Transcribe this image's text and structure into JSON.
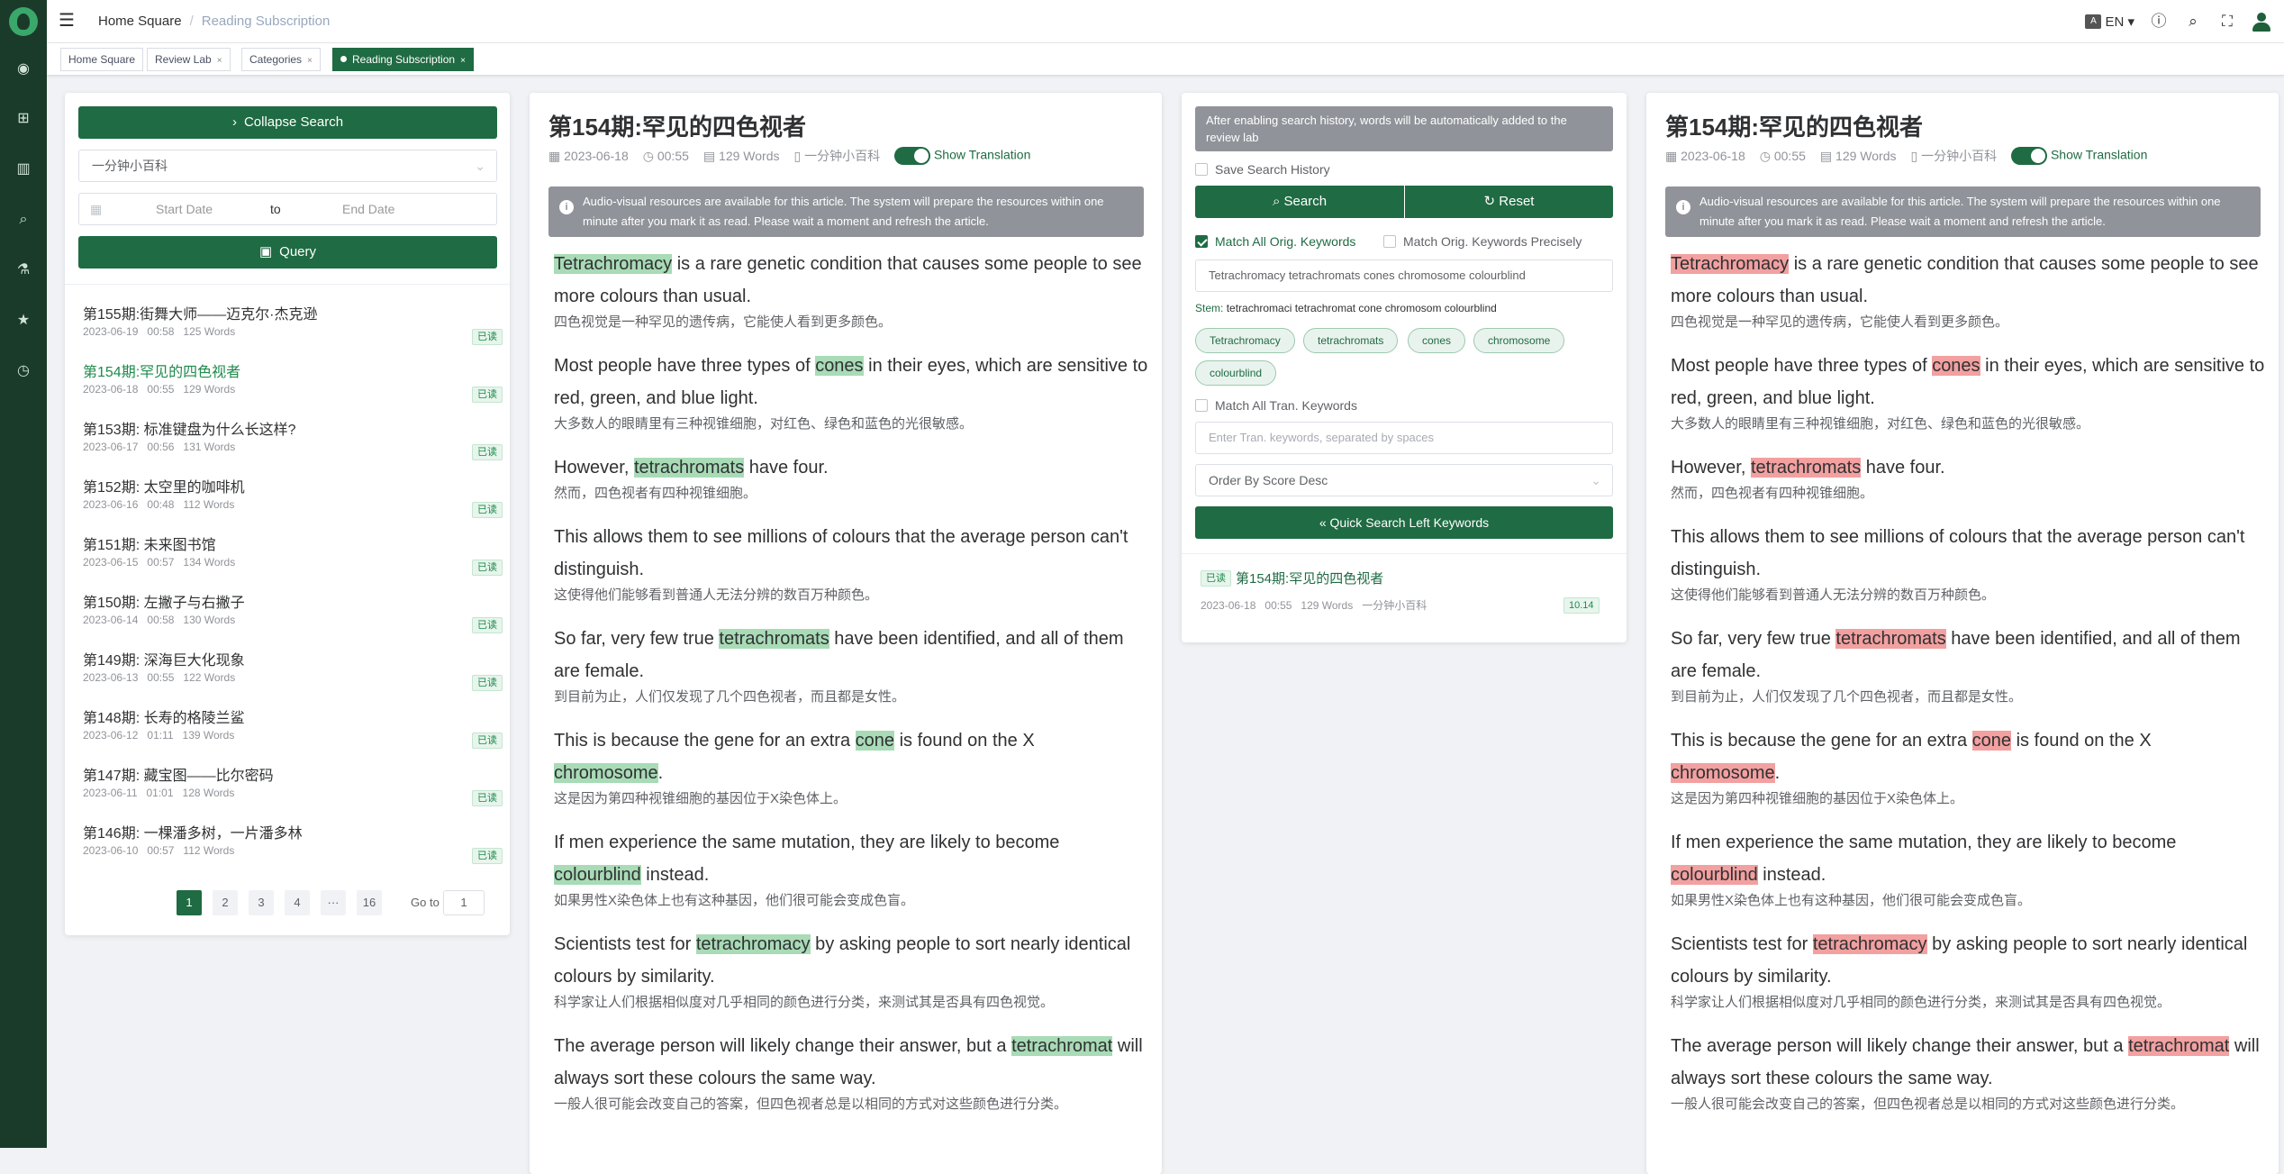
{
  "header": {
    "crumb_home": "Home Square",
    "crumb_sep": "/",
    "crumb_current": "Reading Subscription",
    "lang_box": "A",
    "lang": "EN ▾"
  },
  "tabs": [
    {
      "label": "Home Square"
    },
    {
      "label": "Review Lab"
    },
    {
      "label": "Categories"
    },
    {
      "label": "Reading Subscription"
    }
  ],
  "tab_close": "×",
  "search": {
    "collapse_label": "Collapse Search",
    "category": "一分钟小百科",
    "start_placeholder": "Start Date",
    "to": "to",
    "end_placeholder": "End Date",
    "query_label": "Query"
  },
  "list": [
    {
      "title": "第155期:街舞大师——迈克尔·杰克逊",
      "date": "2023-06-19",
      "dur": "00:58",
      "words": "125 Words",
      "badge": "已读"
    },
    {
      "title": "第154期:罕见的四色视者",
      "date": "2023-06-18",
      "dur": "00:55",
      "words": "129 Words",
      "badge": "已读"
    },
    {
      "title": "第153期: 标准键盘为什么长这样?",
      "date": "2023-06-17",
      "dur": "00:56",
      "words": "131 Words",
      "badge": "已读"
    },
    {
      "title": "第152期: 太空里的咖啡机",
      "date": "2023-06-16",
      "dur": "00:48",
      "words": "112 Words",
      "badge": "已读"
    },
    {
      "title": "第151期: 未来图书馆",
      "date": "2023-06-15",
      "dur": "00:57",
      "words": "134 Words",
      "badge": "已读"
    },
    {
      "title": "第150期: 左撇子与右撇子",
      "date": "2023-06-14",
      "dur": "00:58",
      "words": "130 Words",
      "badge": "已读"
    },
    {
      "title": "第149期: 深海巨大化现象",
      "date": "2023-06-13",
      "dur": "00:55",
      "words": "122 Words",
      "badge": "已读"
    },
    {
      "title": "第148期: 长寿的格陵兰鲨",
      "date": "2023-06-12",
      "dur": "01:11",
      "words": "139 Words",
      "badge": "已读"
    },
    {
      "title": "第147期: 藏宝图——比尔密码",
      "date": "2023-06-11",
      "dur": "01:01",
      "words": "128 Words",
      "badge": "已读"
    },
    {
      "title": "第146期: 一棵潘多树，一片潘多林",
      "date": "2023-06-10",
      "dur": "00:57",
      "words": "112 Words",
      "badge": "已读"
    }
  ],
  "pager": {
    "p1": "1",
    "p2": "2",
    "p3": "3",
    "p4": "4",
    "more": "···",
    "last": "16",
    "goto": "Go to",
    "goto_val": "1"
  },
  "article": {
    "title": "第154期:罕见的四色视者",
    "date": "2023-06-18",
    "dur": "00:55",
    "words": "129 Words",
    "cat": "一分钟小百科",
    "show_translation": "Show Translation",
    "notice": "Audio-visual resources are available for this article. The system will prepare the resources within one minute after you mark it as read. Please wait a moment and refresh the article.",
    "sentences": [
      {
        "pre": "",
        "kw": "Tetrachromacy",
        "post": " is a rare genetic condition that causes some people to see more colours than usual.",
        "zh": "四色视觉是一种罕见的遗传病，它能使人看到更多颜色。"
      },
      {
        "pre": "Most people have three types of ",
        "kw": "cones",
        "post": " in their eyes, which are sensitive to red, green, and blue light.",
        "zh": "大多数人的眼睛里有三种视锥细胞，对红色、绿色和蓝色的光很敏感。"
      },
      {
        "pre": "However, ",
        "kw": "tetrachromats",
        "post": " have four.",
        "zh": "然而，四色视者有四种视锥细胞。"
      },
      {
        "pre": "This allows them to see millions of colours that the average person can't distinguish.",
        "kw": "",
        "post": "",
        "zh": "这使得他们能够看到普通人无法分辨的数百万种颜色。"
      },
      {
        "pre": "So far, very few true ",
        "kw": "tetrachromats",
        "post": " have been identified, and all of them are female.",
        "zh": "到目前为止，人们仅发现了几个四色视者，而且都是女性。"
      },
      {
        "pre": "This is because the gene for an extra ",
        "kw": "cone",
        "post": " is found on the X ",
        "kw2": "chromosome",
        "post2": ".",
        "zh": "这是因为第四种视锥细胞的基因位于X染色体上。"
      },
      {
        "pre": "If men experience the same mutation, they are likely to become ",
        "kw": "colourblind",
        "post": " instead.",
        "zh": "如果男性X染色体上也有这种基因，他们很可能会变成色盲。"
      },
      {
        "pre": "Scientists test for ",
        "kw": "tetrachromacy",
        "post": " by asking people to sort nearly identical colours by similarity.",
        "zh": "科学家让人们根据相似度对几乎相同的颜色进行分类，来测试其是否具有四色视觉。"
      },
      {
        "pre": "The average person will likely change their answer, but a ",
        "kw": "tetrachromat",
        "post": " will always sort these colours the same way.",
        "zh": "一般人很可能会改变自己的答案，但四色视者总是以相同的方式对这些颜色进行分类。"
      }
    ]
  },
  "kw_search": {
    "info": "After enabling search history, words will be automatically added to the review lab",
    "save_history": "Save Search History",
    "search": "Search",
    "reset": "Reset",
    "match_all": "Match All Orig. Keywords",
    "match_precise": "Match Orig. Keywords Precisely",
    "keywords": "Tetrachromacy tetrachromats cones chromosome colourblind",
    "stem_label": "Stem:",
    "stem": "tetrachromaci tetrachromat cone chromosom colourblind",
    "chips": [
      "Tetrachromacy",
      "tetrachromats",
      "cones",
      "chromosome",
      "colourblind"
    ],
    "match_tran": "Match All Tran. Keywords",
    "tran_placeholder": "Enter Tran. keywords, separated by spaces",
    "order": "Order By Score Desc",
    "quick": "Quick Search Left Keywords",
    "result": {
      "badge": "已读",
      "title": "第154期:罕见的四色视者",
      "date": "2023-06-18",
      "dur": "00:55",
      "words": "129 Words",
      "cat": "一分钟小百科",
      "score": "10.14"
    }
  },
  "colors": {
    "accent": "#1f6b43",
    "hl_green": "#a8dbb6",
    "hl_red": "#f2a0a0"
  }
}
